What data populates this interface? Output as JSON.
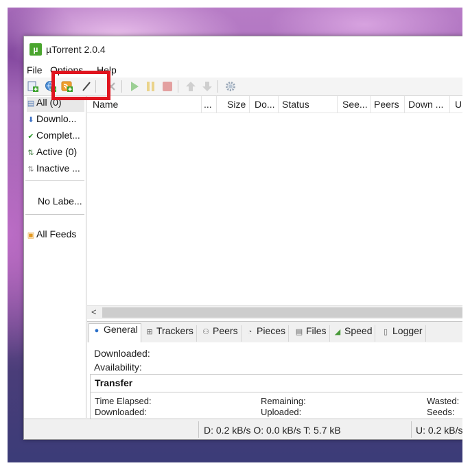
{
  "window": {
    "title": "µTorrent 2.0.4",
    "app_icon_glyph": "µ"
  },
  "menu": {
    "file": "File",
    "options": "Options",
    "help": "Help"
  },
  "toolbar": {
    "icons": [
      "add-torrent-icon",
      "add-url-icon",
      "create-torrent-icon",
      "remove-icon",
      "start-icon",
      "pause-icon",
      "stop-icon",
      "move-up-icon",
      "move-down-icon",
      "preferences-icon"
    ]
  },
  "sidebar": {
    "all": "All (0)",
    "downloading": "Downlo...",
    "completed": "Complet...",
    "active": "Active (0)",
    "inactive": "Inactive ...",
    "no_label": "No Labe...",
    "all_feeds": "All Feeds"
  },
  "list": {
    "columns": {
      "name": "Name",
      "ellipsis": "...",
      "size": "Size",
      "done": "Do...",
      "status": "Status",
      "seeds": "See...",
      "peers": "Peers",
      "down": "Down ...",
      "up": "U"
    },
    "scroll_left": "<"
  },
  "tabs": {
    "general": "General",
    "trackers": "Trackers",
    "peers": "Peers",
    "pieces": "Pieces",
    "files": "Files",
    "speed": "Speed",
    "logger": "Logger"
  },
  "details": {
    "downloaded": "Downloaded:",
    "availability": "Availability:",
    "transfer_title": "Transfer",
    "time_elapsed": "Time Elapsed:",
    "remaining": "Remaining:",
    "wasted": "Wasted:",
    "downloaded2": "Downloaded:",
    "uploaded": "Uploaded:",
    "seeds": "Seeds:"
  },
  "status": {
    "down": "D: 0.2 kB/s O: 0.0 kB/s T: 5.7 kB",
    "up": "U: 0.2 kB/s"
  },
  "colors": {
    "highlight": "#e0141e",
    "app_green": "#4aa52e"
  }
}
